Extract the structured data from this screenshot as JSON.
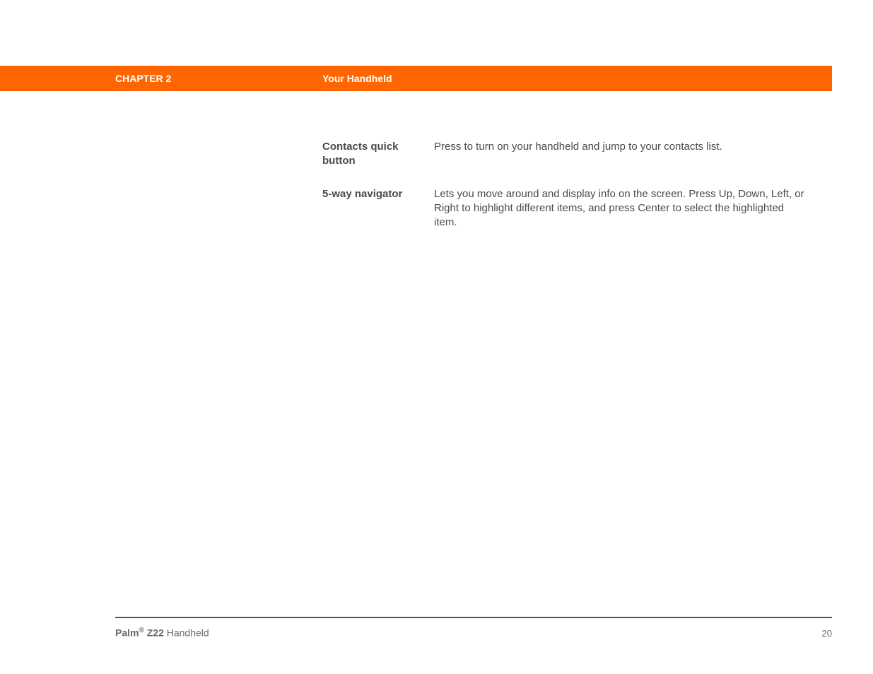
{
  "header": {
    "chapter": "CHAPTER 2",
    "title": "Your Handheld"
  },
  "definitions": [
    {
      "term": "Contacts quick button",
      "description": "Press to turn on your handheld and jump to your contacts list."
    },
    {
      "term": "5-way navigator",
      "description": "Lets you move around and display info on the screen. Press Up, Down, Left, or Right to highlight different items, and press Center to select the highlighted item."
    }
  ],
  "footer": {
    "brand_name": "Palm",
    "brand_reg": "®",
    "brand_model": " Z22 ",
    "brand_suffix": "Handheld",
    "page_number": "20"
  }
}
